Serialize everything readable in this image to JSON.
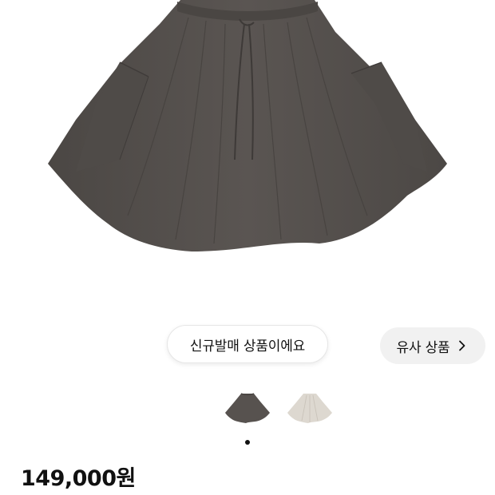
{
  "product": {
    "new_release_label": "신규발매 상품이에요",
    "similar_products_label": "유사 상품",
    "price": "149,000원"
  },
  "colors": {
    "skirt_dark": "#57524f",
    "skirt_light": "#ddd8d0",
    "pill_similar_bg": "#f1f1f1",
    "text": "#111111"
  },
  "icons": {
    "similar_arrow": "chevron-right-icon"
  },
  "carousel": {
    "variant_count": 2,
    "selected_variant": 1
  }
}
